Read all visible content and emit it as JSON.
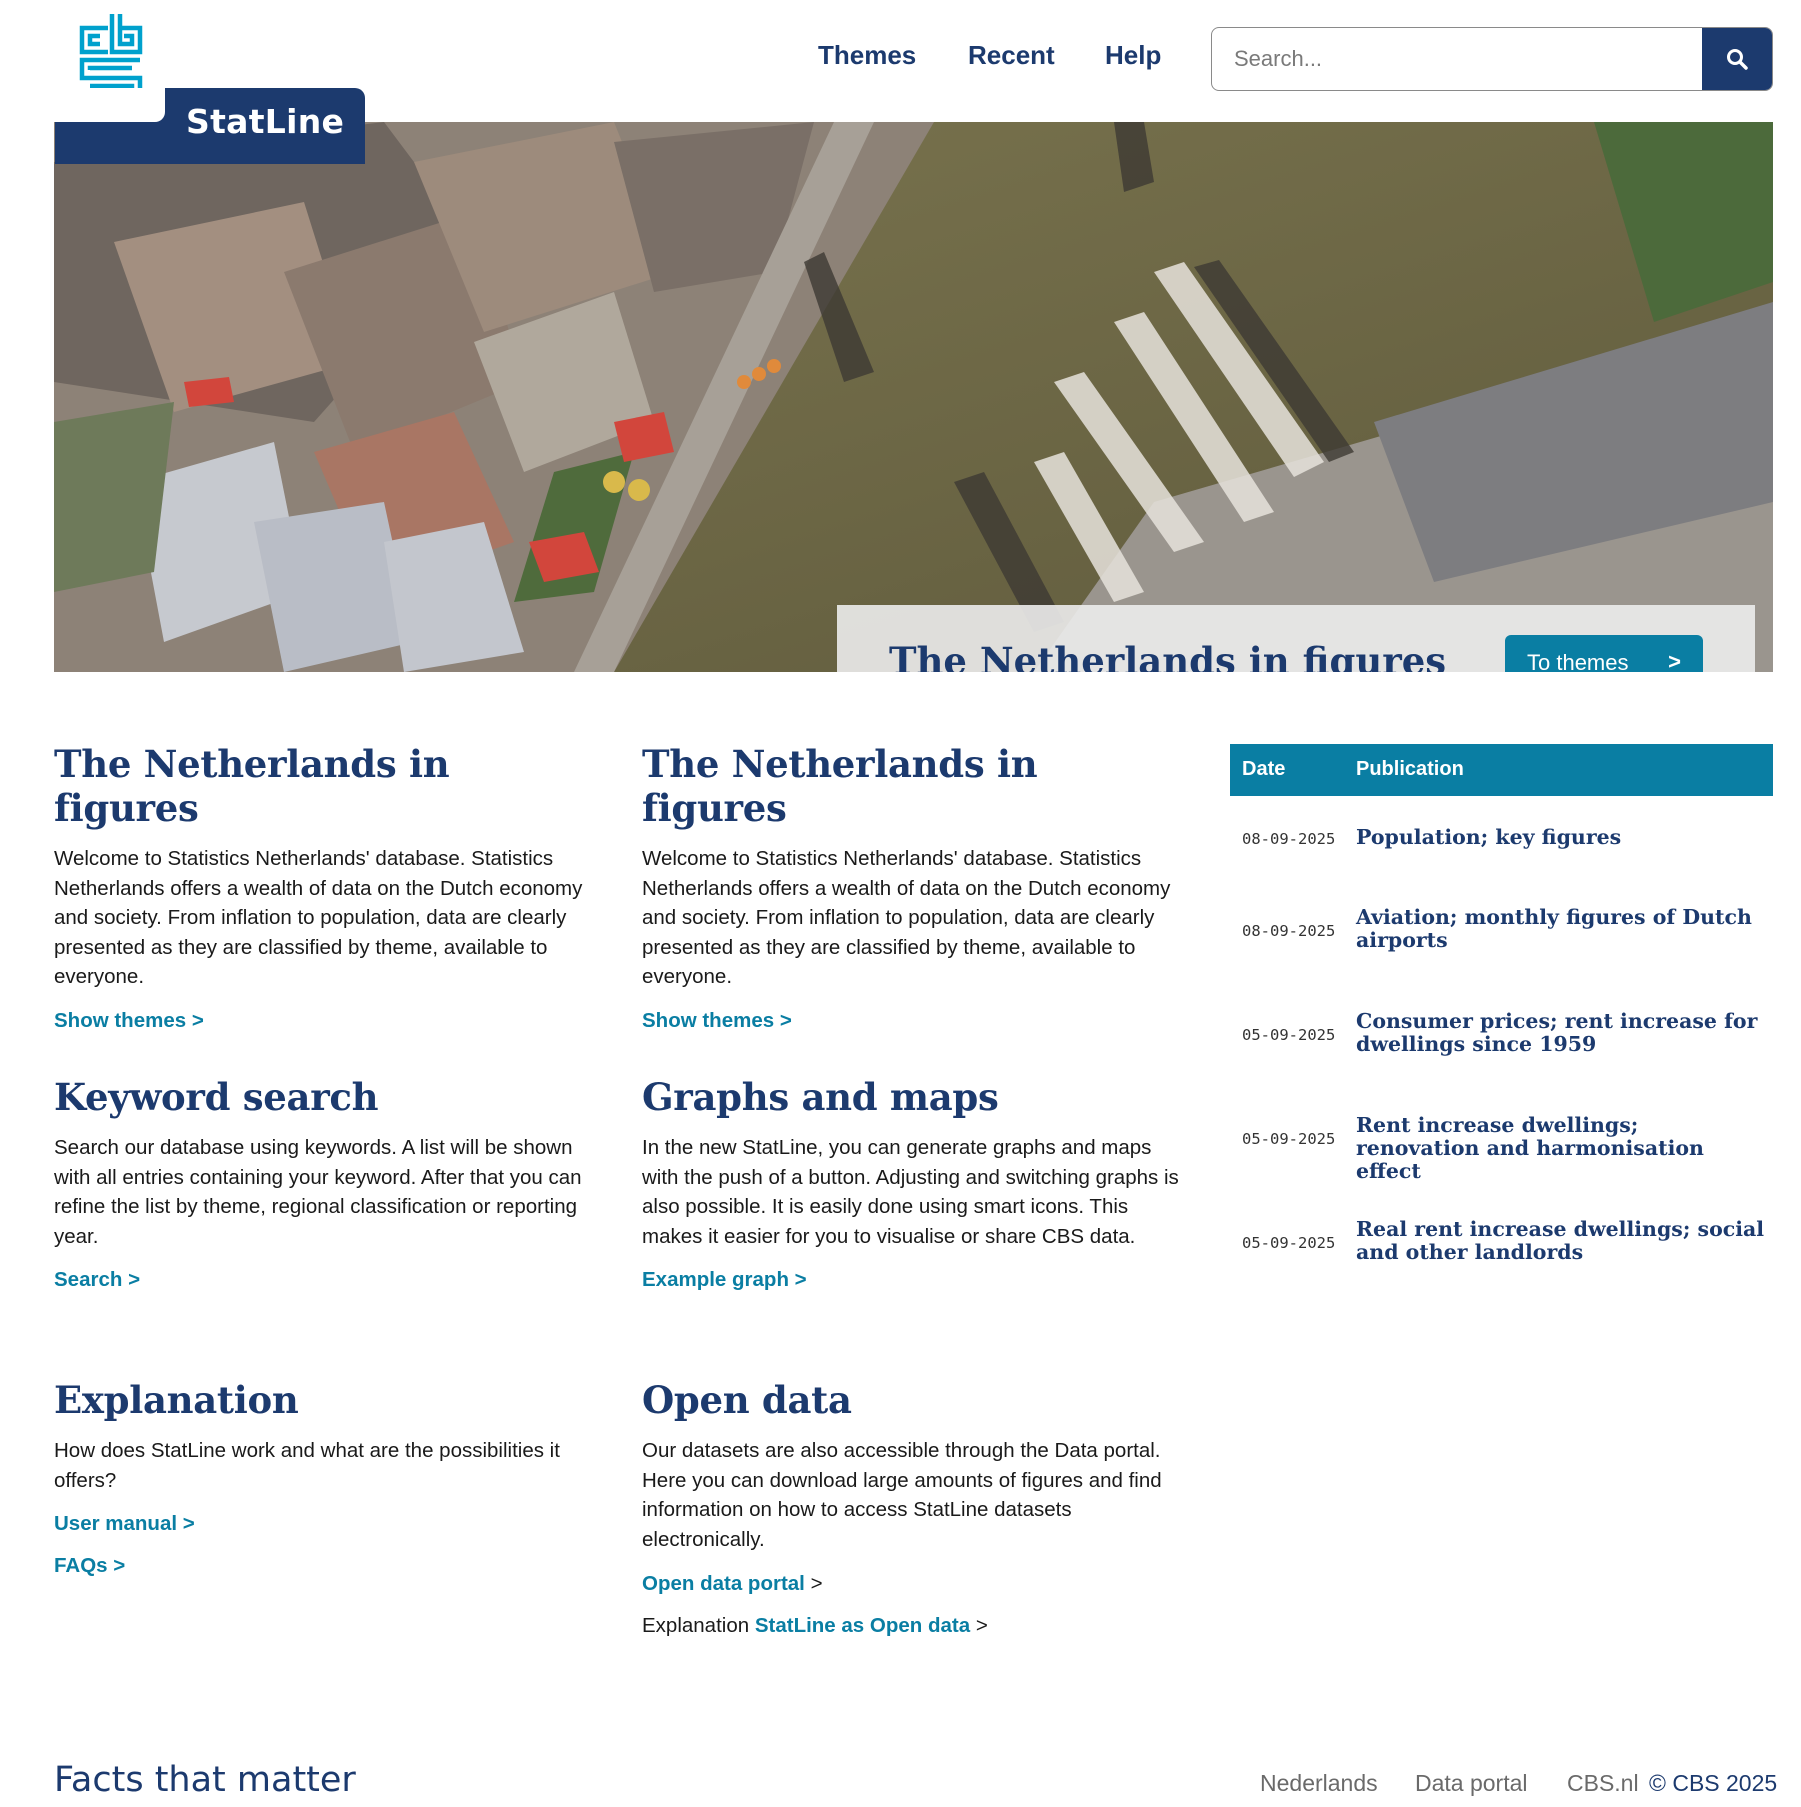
{
  "header": {
    "brand": "StatLine",
    "nav": {
      "themes": "Themes",
      "recent": "Recent",
      "help": "Help"
    },
    "search": {
      "placeholder": "Search..."
    }
  },
  "hero": {
    "title": "The Netherlands in figures",
    "button": "To themes",
    "button_chevron": ">"
  },
  "blocks": [
    {
      "title": "The Netherlands in figures",
      "text": "Welcome to Statistics Netherlands' database. Statistics Netherlands offers a wealth of data on the Dutch economy and society. From inflation to population, data are clearly presented as they are classified by theme, available to everyone.",
      "links": [
        "Show themes >"
      ]
    },
    {
      "title": "The Netherlands in figures",
      "text": "Welcome to Statistics Netherlands' database. Statistics Netherlands offers a wealth of data on the Dutch economy and society. From inflation to population, data are clearly presented as they are classified by theme, available to everyone.",
      "links": [
        "Show themes >"
      ]
    },
    {
      "title": "Keyword search",
      "text": "Search our database using keywords. A list will be shown with all entries containing your keyword. After that you can refine the list by theme, regional classification or reporting year.",
      "links": [
        "Search >"
      ]
    },
    {
      "title": "Graphs and maps",
      "text": "In the new StatLine, you can generate graphs and maps with the push of a button. Adjusting and switching graphs is also possible. It is easily done using smart icons. This makes it easier for you to visualise or share CBS data.",
      "links": [
        "Example graph >"
      ]
    },
    {
      "title": "Explanation",
      "text": "How does StatLine work and what are the possibilities it offers?",
      "links": [
        "User manual >",
        "FAQs >"
      ]
    },
    {
      "title": "Open data",
      "text": "Our datasets are also accessible through the Data portal. Here you can download large amounts of figures and find information on how to access StatLine datasets electronically.",
      "portal_link": "Open data portal",
      "portal_suffix": " >",
      "explanation_prefix": "Explanation ",
      "explanation_link": "StatLine as Open data",
      "explanation_suffix": " >"
    }
  ],
  "publications": {
    "headers": {
      "date": "Date",
      "publication": "Publication"
    },
    "rows": [
      {
        "date": "08-09-2025",
        "title": "Population; key figures"
      },
      {
        "date": "08-09-2025",
        "title": "Aviation; monthly figures of Dutch airports"
      },
      {
        "date": "05-09-2025",
        "title": "Consumer prices; rent increase for dwellings since 1959"
      },
      {
        "date": "05-09-2025",
        "title": "Rent increase dwellings; renovation and harmonisation effect"
      },
      {
        "date": "05-09-2025",
        "title": "Real rent increase dwellings; social and other landlords"
      }
    ]
  },
  "footer": {
    "tagline": "Facts that matter",
    "links": {
      "nederlands": "Nederlands",
      "data_portal": "Data portal",
      "cbs": "CBS.nl"
    },
    "copyright": "© CBS 2025"
  },
  "colors": {
    "primary": "#1c3a6e",
    "accent": "#0a7ea3",
    "logo": "#00a1cd"
  },
  "icons": {
    "logo": "cbs-logo-icon",
    "search": "search-icon"
  }
}
